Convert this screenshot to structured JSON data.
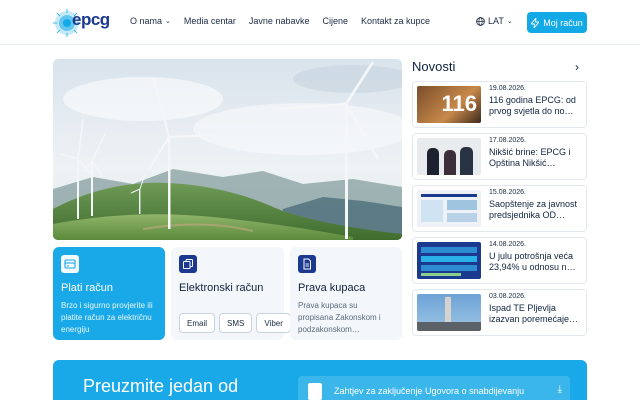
{
  "header": {
    "logo_text": "epcg",
    "nav": [
      {
        "label": "O nama",
        "has_chevron": true
      },
      {
        "label": "Media centar",
        "has_chevron": false
      },
      {
        "label": "Javne nabavke",
        "has_chevron": false
      },
      {
        "label": "Cijene",
        "has_chevron": false
      },
      {
        "label": "Kontakt za kupce",
        "has_chevron": false
      }
    ],
    "language": "LAT",
    "account_button": "Moj račun",
    "icons": {
      "globe": "globe-icon",
      "chevron": "chevron-down-icon",
      "bolt": "bolt-icon"
    }
  },
  "hero": {
    "image": "wind-turbines-landscape"
  },
  "cards": [
    {
      "title": "Plati račun",
      "description": "Brzo i sigurno provjerite ili platite račun za električnu energiju",
      "icon": "card-payment-icon"
    },
    {
      "title": "Elektronski račun",
      "pills": [
        "Email",
        "SMS",
        "Viber"
      ],
      "icon": "copy-document-icon"
    },
    {
      "title": "Prava kupaca",
      "description": "Prava kupaca su propisana Zakonskom i podzakonskom…",
      "icon": "document-icon"
    }
  ],
  "news": {
    "title": "Novosti",
    "items": [
      {
        "date": "19.08.2026.",
        "headline": "116 godina EPCG: od prvog svjetla do no…",
        "thumb_text": "116"
      },
      {
        "date": "17.08.2026.",
        "headline": "Nikšić brine: EPCG i Opština Nikšić…"
      },
      {
        "date": "15.08.2026.",
        "headline": "Saopštenje za javnost predsjednika OD…"
      },
      {
        "date": "14.08.2026.",
        "headline": "U julu potrošnja veća 23,94% u odnosu n…"
      },
      {
        "date": "03.08.2026.",
        "headline": "Ispad TE Pljevlja izazvan poremećaje…"
      }
    ]
  },
  "banner": {
    "title": "Preuzmite jedan od",
    "document": "Zahtjev za zaključenje Ugovora o snabdijevanju"
  },
  "colors": {
    "accent": "#12a9e6",
    "navy": "#1b3a8f",
    "text": "#0f2340"
  }
}
